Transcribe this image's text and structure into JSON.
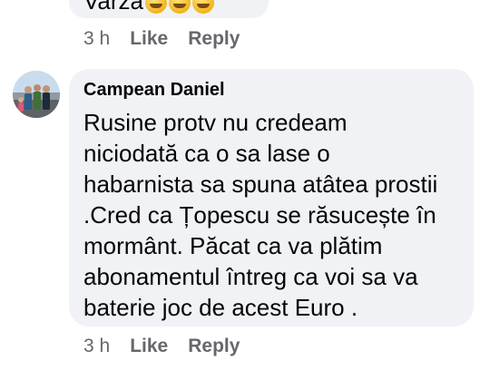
{
  "previous_comment": {
    "text": "Varza"
  },
  "previous_actions": {
    "time": "3 h",
    "like": "Like",
    "reply": "Reply"
  },
  "comment": {
    "author": "Campean Daniel",
    "lines": [
      "Rusine protv nu credeam",
      "niciodată ca o sa lase o",
      "habarnista sa spuna atâtea prostii",
      ".Cred ca Țopescu se răsucește în",
      "mormânt. Păcat ca va plătim",
      "abonamentul întreg ca voi sa va",
      "baterie joc de acest Euro ."
    ]
  },
  "comment_actions": {
    "time": "3 h",
    "like": "Like",
    "reply": "Reply"
  }
}
